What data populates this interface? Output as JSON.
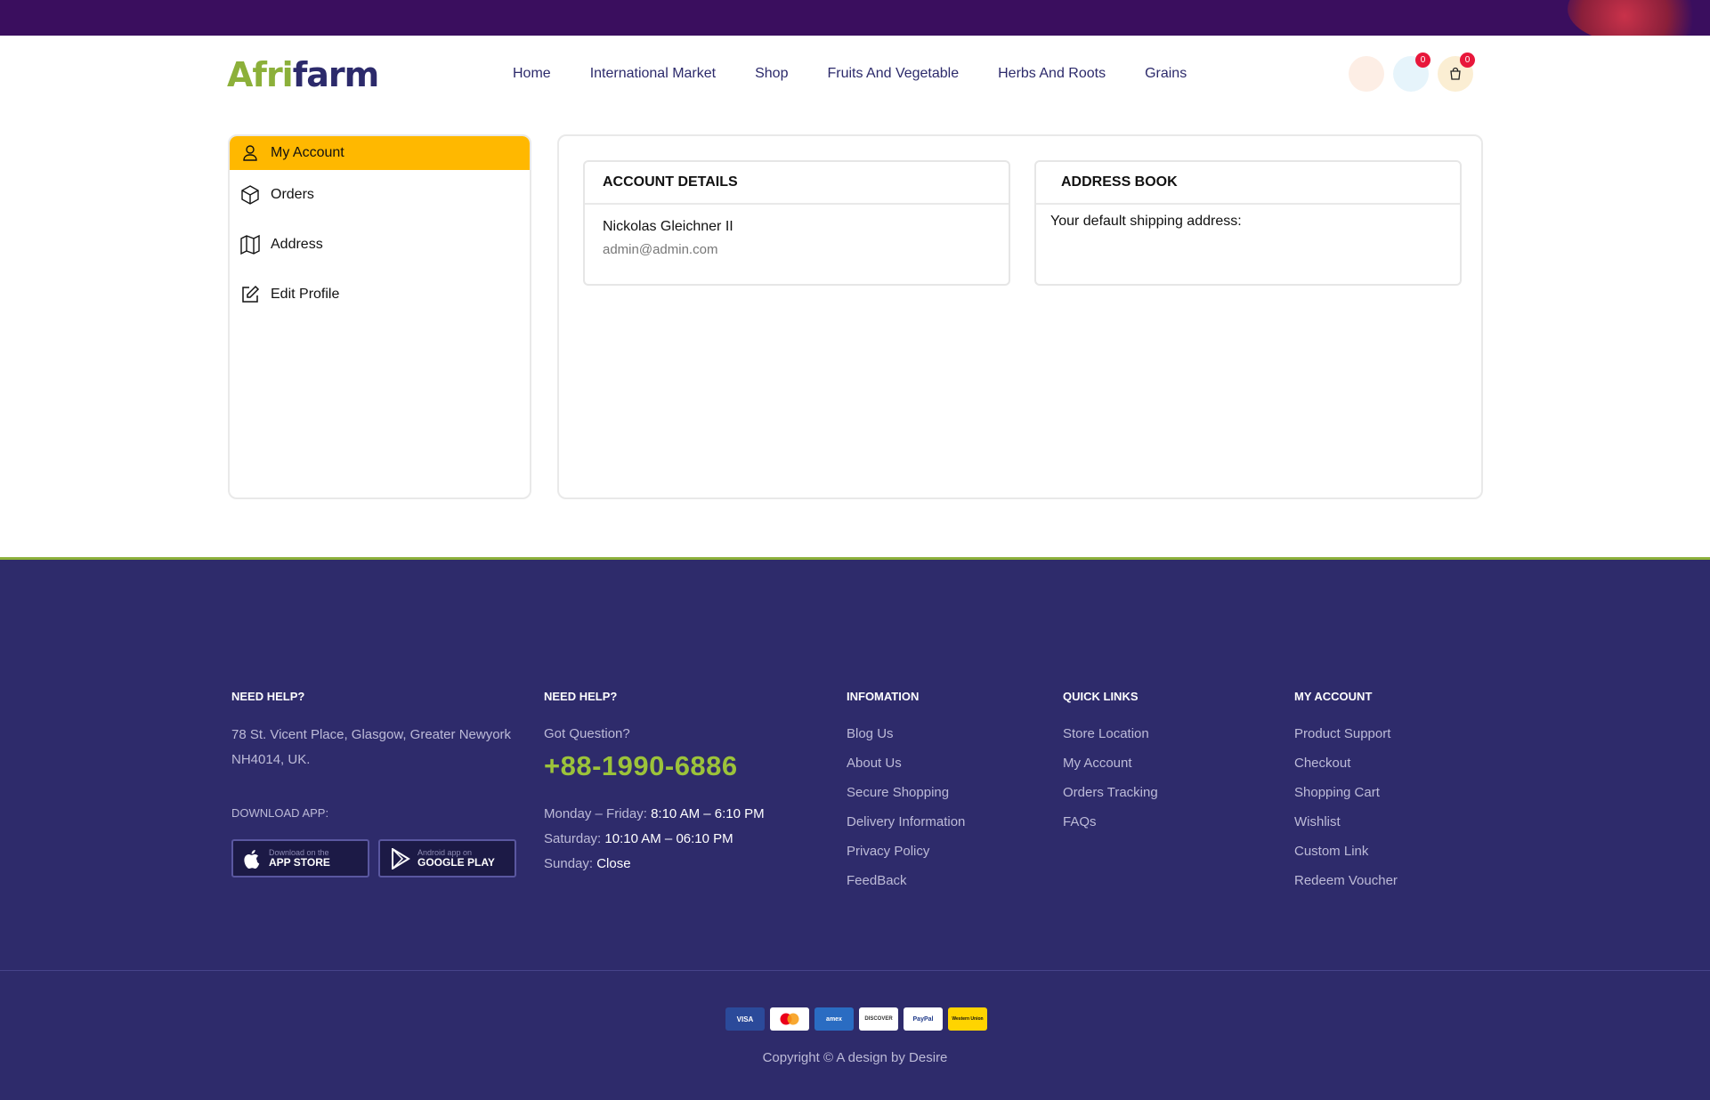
{
  "logo": {
    "part1": "Afri",
    "part2": "farm"
  },
  "nav": [
    "Home",
    "International Market",
    "Shop",
    "Fruits And Vegetable",
    "Herbs And Roots",
    "Grains"
  ],
  "header_icons": {
    "wishlist_count": "0",
    "cart_count": "0"
  },
  "sidebar": {
    "items": [
      {
        "label": "My Account",
        "icon": "user-icon"
      },
      {
        "label": "Orders",
        "icon": "box-icon"
      },
      {
        "label": "Address",
        "icon": "map-icon"
      },
      {
        "label": "Edit Profile",
        "icon": "edit-icon"
      }
    ]
  },
  "account_details": {
    "title": "ACCOUNT DETAILS",
    "name": "Nickolas Gleichner II",
    "email": "admin@admin.com"
  },
  "address_book": {
    "title": "ADDRESS BOOK",
    "text": "Your default shipping address:"
  },
  "footer": {
    "col1": {
      "heading": "NEED HELP?",
      "address": "78 St. Vicent Place, Glasgow, Greater Newyork NH4014, UK.",
      "download_label": "DOWNLOAD APP:",
      "appstore_small": "Download on the",
      "appstore_big": "APP STORE",
      "googleplay_small": "Android app on",
      "googleplay_big": "GOOGLE PLAY"
    },
    "col2": {
      "heading": "NEED HELP?",
      "question": "Got Question?",
      "phone": "+88-1990-6886",
      "mf_label": "Monday – Friday:",
      "mf_value": "8:10 AM – 6:10 PM",
      "sat_label": "Saturday:",
      "sat_value": "10:10 AM – 06:10 PM",
      "sun_label": "Sunday:",
      "sun_value": "Close"
    },
    "col3": {
      "heading": "INFOMATION",
      "links": [
        "Blog Us",
        "About Us",
        "Secure Shopping",
        "Delivery Information",
        "Privacy Policy",
        "FeedBack"
      ]
    },
    "col4": {
      "heading": "QUICK LINKS",
      "links": [
        "Store Location",
        "My Account",
        "Orders Tracking",
        "FAQs"
      ]
    },
    "col5": {
      "heading": "MY ACCOUNT",
      "links": [
        "Product Support",
        "Checkout",
        "Shopping Cart",
        "Wishlist",
        "Custom Link",
        "Redeem Voucher"
      ]
    },
    "payments": [
      "VISA",
      "mastercard",
      "amex",
      "DISCOVER",
      "PayPal",
      "Western Union"
    ],
    "copyright": "Copyright © A design by Desire"
  },
  "colors": {
    "topbar": "#3a0e5e",
    "accent": "#ffb800",
    "footer_bg": "#2e2b6b",
    "brand_green": "#8cb03a",
    "brand_navy": "#2c2a6b"
  }
}
